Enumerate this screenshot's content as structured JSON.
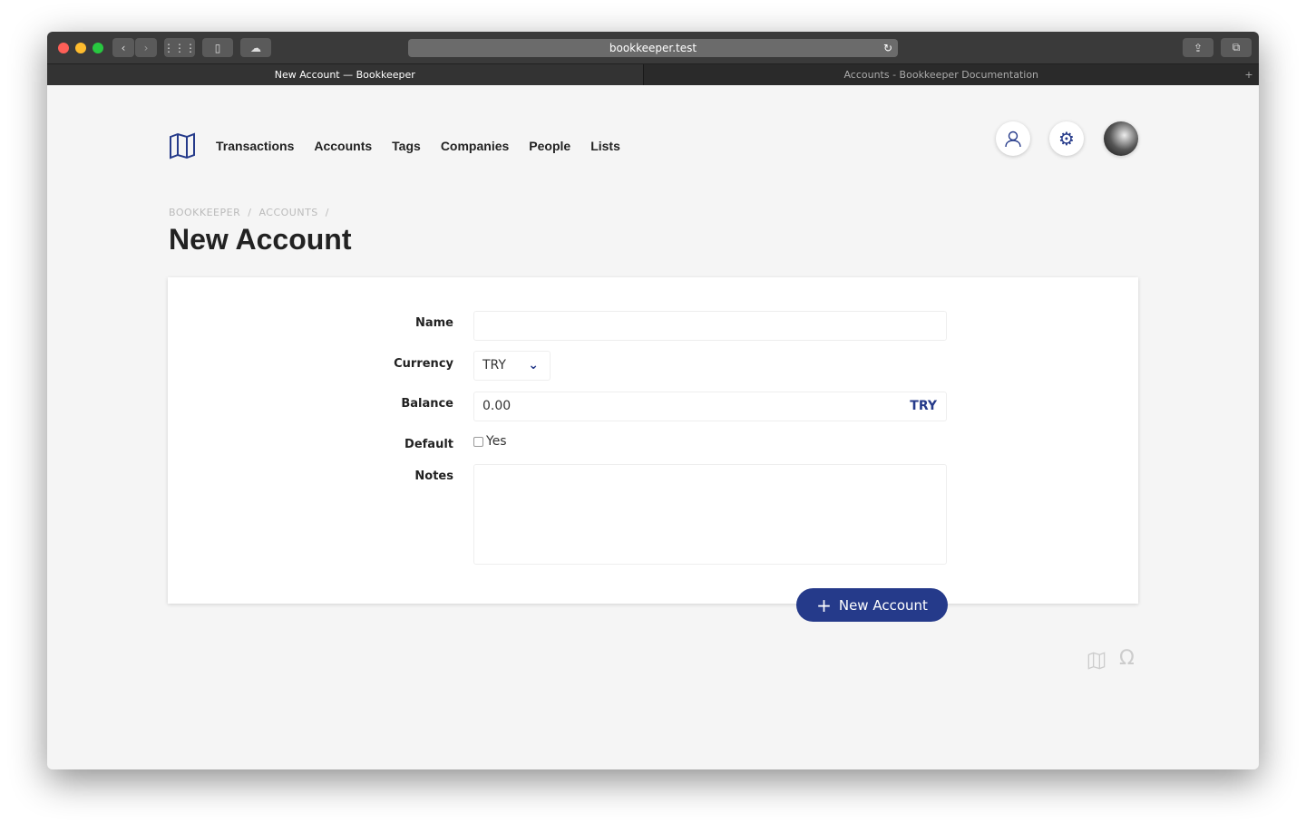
{
  "browser": {
    "url": "bookkeeper.test",
    "tabs": [
      "New Account — Bookkeeper",
      "Accounts - Bookkeeper Documentation"
    ]
  },
  "nav": {
    "items": [
      "Transactions",
      "Accounts",
      "Tags",
      "Companies",
      "People",
      "Lists"
    ]
  },
  "breadcrumb": [
    "BOOKKEEPER",
    "ACCOUNTS"
  ],
  "page": {
    "title": "New Account"
  },
  "form": {
    "name_label": "Name",
    "name_value": "",
    "currency_label": "Currency",
    "currency_value": "TRY",
    "balance_label": "Balance",
    "balance_value": "0.00",
    "balance_suffix": "TRY",
    "default_label": "Default",
    "default_option": "Yes",
    "default_checked": false,
    "notes_label": "Notes",
    "notes_value": "",
    "submit_label": "New Account"
  },
  "colors": {
    "accent": "#253a8a",
    "background": "#f5f5f5"
  }
}
